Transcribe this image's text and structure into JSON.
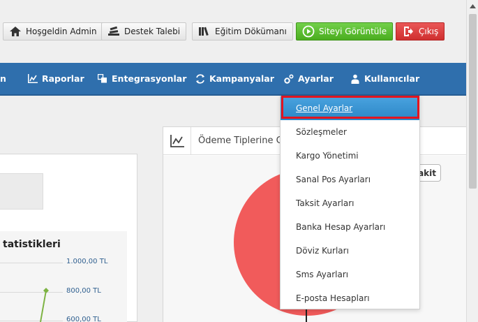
{
  "toolbar": {
    "welcome": "Hoşgeldin Admin",
    "support": "Destek Talebi",
    "docs": "Eğitim Dökümanı",
    "view_site": "Siteyi Görüntüle",
    "logout": "Çıkış"
  },
  "nav": {
    "items": [
      {
        "label": "Raporlar",
        "icon": "chart-icon"
      },
      {
        "label": "Entegrasyonlar",
        "icon": "puzzle-icon"
      },
      {
        "label": "Kampanyalar",
        "icon": "refresh-icon"
      },
      {
        "label": "Ayarlar",
        "icon": "gears-icon"
      },
      {
        "label": "Kullanıcılar",
        "icon": "users-icon"
      }
    ],
    "partial_left": "n"
  },
  "dropdown": {
    "items": [
      "Genel Ayarlar",
      "Sözleşmeler",
      "Kargo Yönetimi",
      "Sanal Pos Ayarları",
      "Taksit Ayarları",
      "Banka Hesap Ayarları",
      "Döviz Kurları",
      "Sms Ayarları",
      "E-posta Hesapları"
    ],
    "active_index": 0
  },
  "left_panel": {
    "chart_title": "tatistikleri",
    "axis": [
      "1.000,00 TL",
      "800,00 TL",
      "600,00 TL"
    ]
  },
  "right_panel": {
    "title": "Ödeme Tiplerine G",
    "button": "akit"
  },
  "colors": {
    "nav": "#2f6fad",
    "active": "#2b86c6",
    "highlight": "#e3141f",
    "pie": "#f15b5b",
    "green": "#4aad1f",
    "red": "#cf2f2f"
  }
}
